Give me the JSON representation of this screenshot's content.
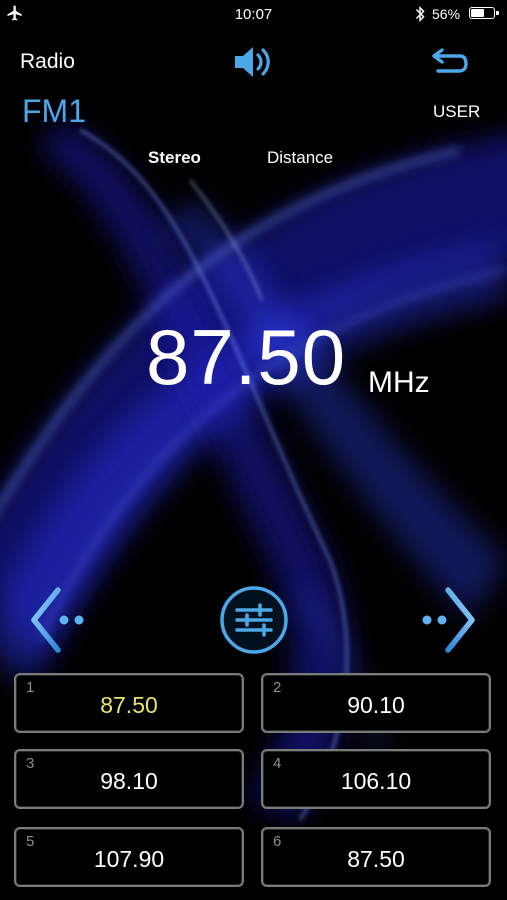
{
  "status_bar": {
    "time": "10:07",
    "battery_percent": "56%",
    "battery_level": 0.56
  },
  "header": {
    "title": "Radio",
    "band": "FM1",
    "user_label": "USER"
  },
  "indicators": {
    "stereo": "Stereo",
    "distance": "Distance"
  },
  "tuner": {
    "frequency": "87.50",
    "unit": "MHz"
  },
  "presets": [
    {
      "number": "1",
      "frequency": "87.50",
      "active": true
    },
    {
      "number": "2",
      "frequency": "90.10",
      "active": false
    },
    {
      "number": "3",
      "frequency": "98.10",
      "active": false
    },
    {
      "number": "4",
      "frequency": "106.10",
      "active": false
    },
    {
      "number": "5",
      "frequency": "107.90",
      "active": false
    },
    {
      "number": "6",
      "frequency": "87.50",
      "active": false
    }
  ],
  "icons": {
    "airplane": "airplane-icon",
    "bluetooth": "bluetooth-icon",
    "battery": "battery-icon",
    "volume": "volume-icon",
    "back": "back-arrow-icon",
    "prev": "seek-previous-icon",
    "eq": "equalizer-icon",
    "next": "seek-next-icon"
  },
  "colors": {
    "accent": "#4aa8e8",
    "active_preset": "#e8e46a",
    "background": "#000000"
  }
}
